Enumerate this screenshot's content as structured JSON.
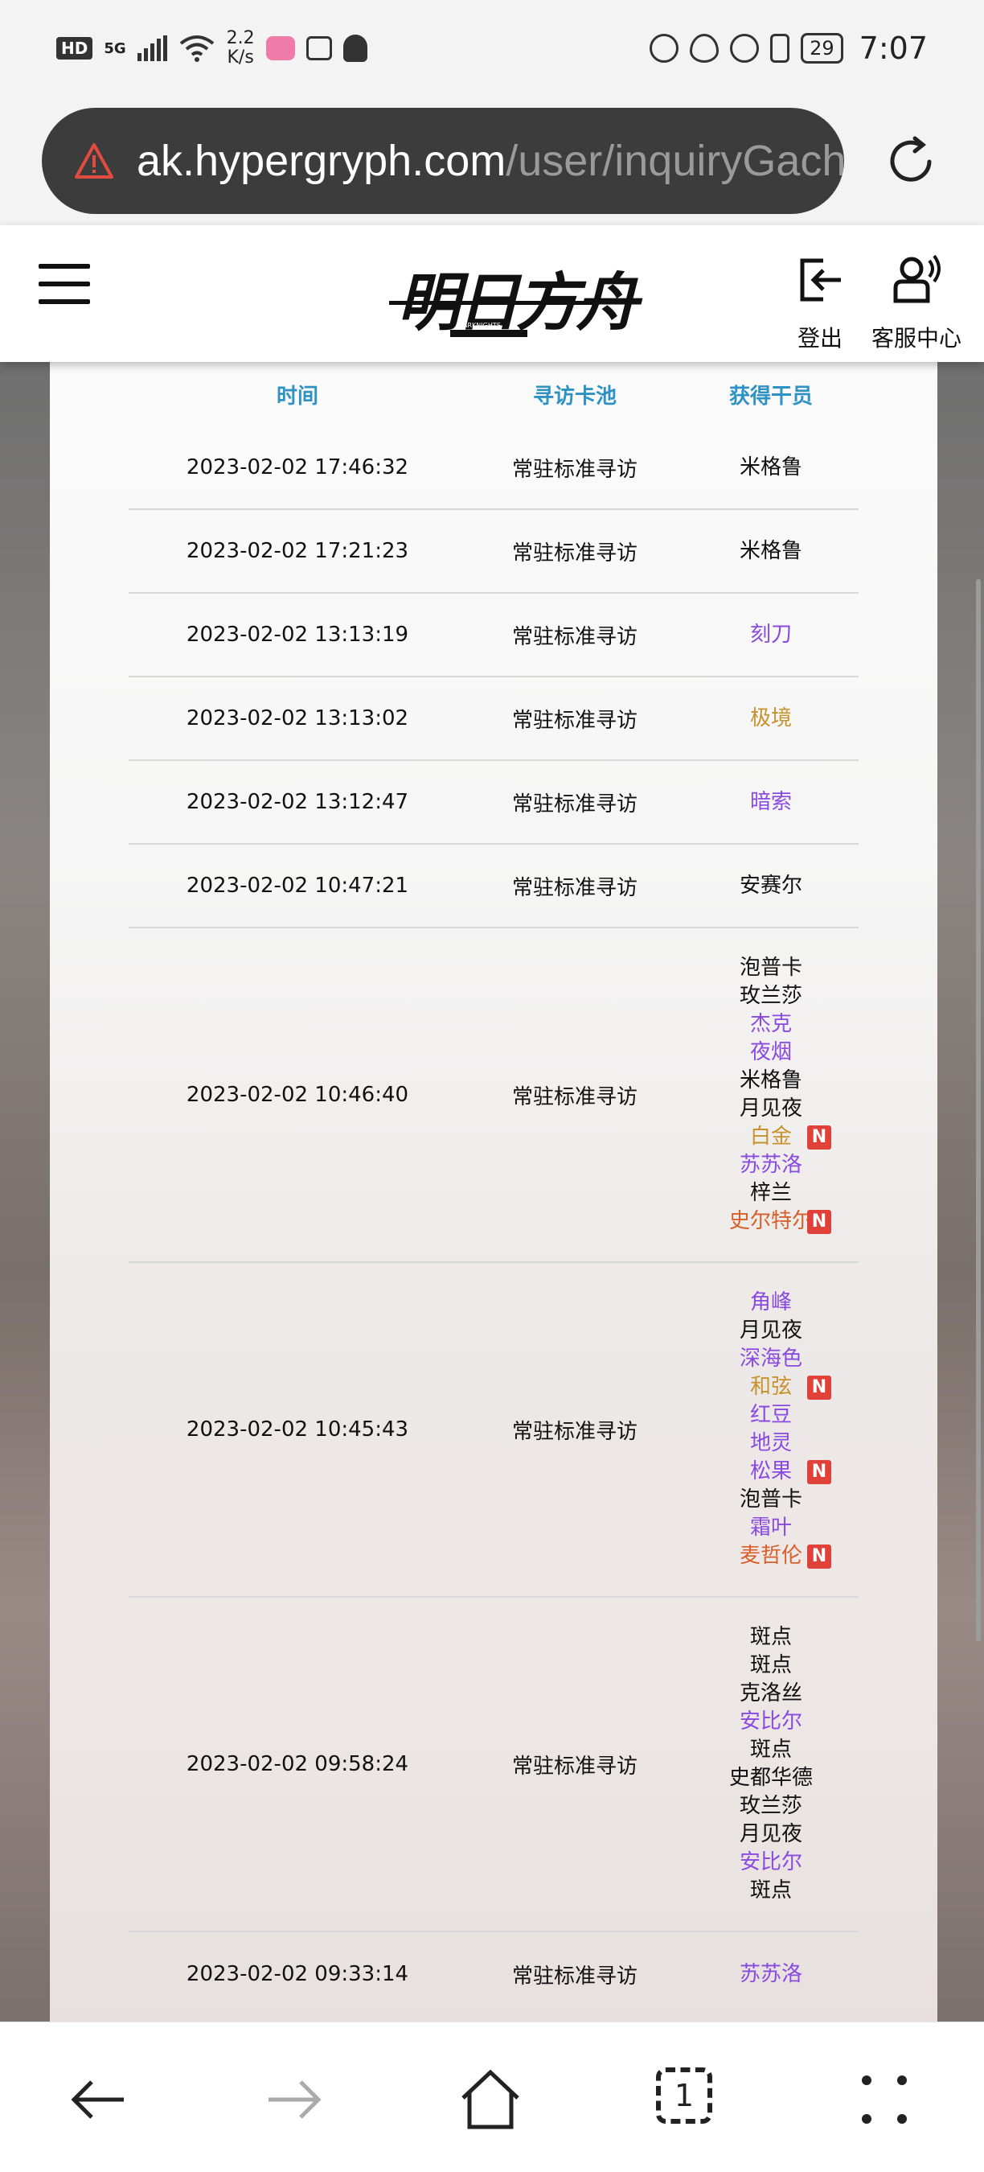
{
  "status_bar": {
    "hd": "HD",
    "network": "5G",
    "speed_value": "2.2",
    "speed_unit": "K/s",
    "battery": "29",
    "time": "7:07"
  },
  "browser": {
    "url_host": "ak.hypergryph.com",
    "url_path": "/user/inquiryGacha"
  },
  "header": {
    "logo_text": "明日方舟",
    "logo_sub": "ARKNIGHTS",
    "logout_label": "登出",
    "service_label": "客服中心"
  },
  "table": {
    "headers": {
      "time": "时间",
      "pool": "寻访卡池",
      "operator": "获得干员"
    },
    "colors": {
      "r3": "#111111",
      "r4": "#8a4ae0",
      "r5": "#c7922c",
      "r6": "#d85f2a"
    },
    "rows": [
      {
        "time": "2023-02-02 17:46:32",
        "pool": "常驻标准寻访",
        "ops": [
          {
            "name": "米格鲁",
            "rarity": "r3",
            "new": false
          }
        ]
      },
      {
        "time": "2023-02-02 17:21:23",
        "pool": "常驻标准寻访",
        "ops": [
          {
            "name": "米格鲁",
            "rarity": "r3",
            "new": false
          }
        ]
      },
      {
        "time": "2023-02-02 13:13:19",
        "pool": "常驻标准寻访",
        "ops": [
          {
            "name": "刻刀",
            "rarity": "r4",
            "new": false
          }
        ]
      },
      {
        "time": "2023-02-02 13:13:02",
        "pool": "常驻标准寻访",
        "ops": [
          {
            "name": "极境",
            "rarity": "r5",
            "new": false
          }
        ]
      },
      {
        "time": "2023-02-02 13:12:47",
        "pool": "常驻标准寻访",
        "ops": [
          {
            "name": "暗索",
            "rarity": "r4",
            "new": false
          }
        ]
      },
      {
        "time": "2023-02-02 10:47:21",
        "pool": "常驻标准寻访",
        "ops": [
          {
            "name": "安赛尔",
            "rarity": "r3",
            "new": false
          }
        ]
      },
      {
        "time": "2023-02-02 10:46:40",
        "pool": "常驻标准寻访",
        "ops": [
          {
            "name": "泡普卡",
            "rarity": "r3",
            "new": false
          },
          {
            "name": "玫兰莎",
            "rarity": "r3",
            "new": false
          },
          {
            "name": "杰克",
            "rarity": "r4",
            "new": false
          },
          {
            "name": "夜烟",
            "rarity": "r4",
            "new": false
          },
          {
            "name": "米格鲁",
            "rarity": "r3",
            "new": false
          },
          {
            "name": "月见夜",
            "rarity": "r3",
            "new": false
          },
          {
            "name": "白金",
            "rarity": "r5",
            "new": true
          },
          {
            "name": "苏苏洛",
            "rarity": "r4",
            "new": false
          },
          {
            "name": "梓兰",
            "rarity": "r3",
            "new": false
          },
          {
            "name": "史尔特尔",
            "rarity": "r6",
            "new": true
          }
        ]
      },
      {
        "time": "2023-02-02 10:45:43",
        "pool": "常驻标准寻访",
        "ops": [
          {
            "name": "角峰",
            "rarity": "r4",
            "new": false
          },
          {
            "name": "月见夜",
            "rarity": "r3",
            "new": false
          },
          {
            "name": "深海色",
            "rarity": "r4",
            "new": false
          },
          {
            "name": "和弦",
            "rarity": "r5",
            "new": true
          },
          {
            "name": "红豆",
            "rarity": "r4",
            "new": false
          },
          {
            "name": "地灵",
            "rarity": "r4",
            "new": false
          },
          {
            "name": "松果",
            "rarity": "r4",
            "new": true
          },
          {
            "name": "泡普卡",
            "rarity": "r3",
            "new": false
          },
          {
            "name": "霜叶",
            "rarity": "r4",
            "new": false
          },
          {
            "name": "麦哲伦",
            "rarity": "r6",
            "new": true
          }
        ]
      },
      {
        "time": "2023-02-02 09:58:24",
        "pool": "常驻标准寻访",
        "ops": [
          {
            "name": "斑点",
            "rarity": "r3",
            "new": false
          },
          {
            "name": "斑点",
            "rarity": "r3",
            "new": false
          },
          {
            "name": "克洛丝",
            "rarity": "r3",
            "new": false
          },
          {
            "name": "安比尔",
            "rarity": "r4",
            "new": false
          },
          {
            "name": "斑点",
            "rarity": "r3",
            "new": false
          },
          {
            "name": "史都华德",
            "rarity": "r3",
            "new": false
          },
          {
            "name": "玫兰莎",
            "rarity": "r3",
            "new": false
          },
          {
            "name": "月见夜",
            "rarity": "r3",
            "new": false
          },
          {
            "name": "安比尔",
            "rarity": "r4",
            "new": false
          },
          {
            "name": "斑点",
            "rarity": "r3",
            "new": false
          }
        ]
      },
      {
        "time": "2023-02-02 09:33:14",
        "pool": "常驻标准寻访",
        "ops": [
          {
            "name": "苏苏洛",
            "rarity": "r4",
            "new": false
          }
        ]
      }
    ],
    "new_badge": "N"
  },
  "icons": {
    "warning": "warning-triangle-icon",
    "reload": "reload-icon",
    "menu": "hamburger-menu-icon",
    "logout": "logout-icon",
    "service": "customer-service-icon",
    "back": "back-arrow-icon",
    "forward": "forward-arrow-icon",
    "home": "home-icon",
    "tabs": "tabs-icon",
    "more": "more-dots-icon"
  },
  "bottom_nav": {
    "tabs_count": "1"
  }
}
